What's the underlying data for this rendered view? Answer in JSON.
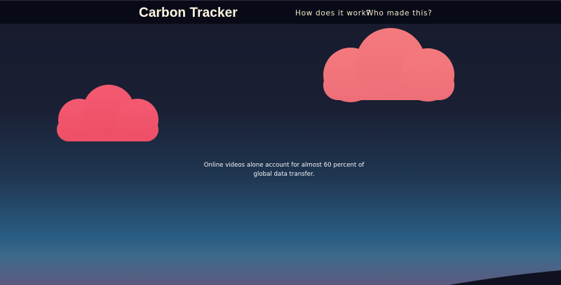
{
  "header": {
    "brand": "Carbon Tracker",
    "nav": [
      {
        "label": "How does it work?"
      },
      {
        "label": "Who made this?"
      }
    ]
  },
  "main": {
    "fact": "Online videos alone account for almost 60 percent of global data transfer."
  },
  "colors": {
    "cloud_left": "#f1546a",
    "cloud_right": "#f1737a",
    "moon_rim": "#f0737d",
    "nav_bg": "#080b17",
    "text_brand": "#fff6e0"
  }
}
